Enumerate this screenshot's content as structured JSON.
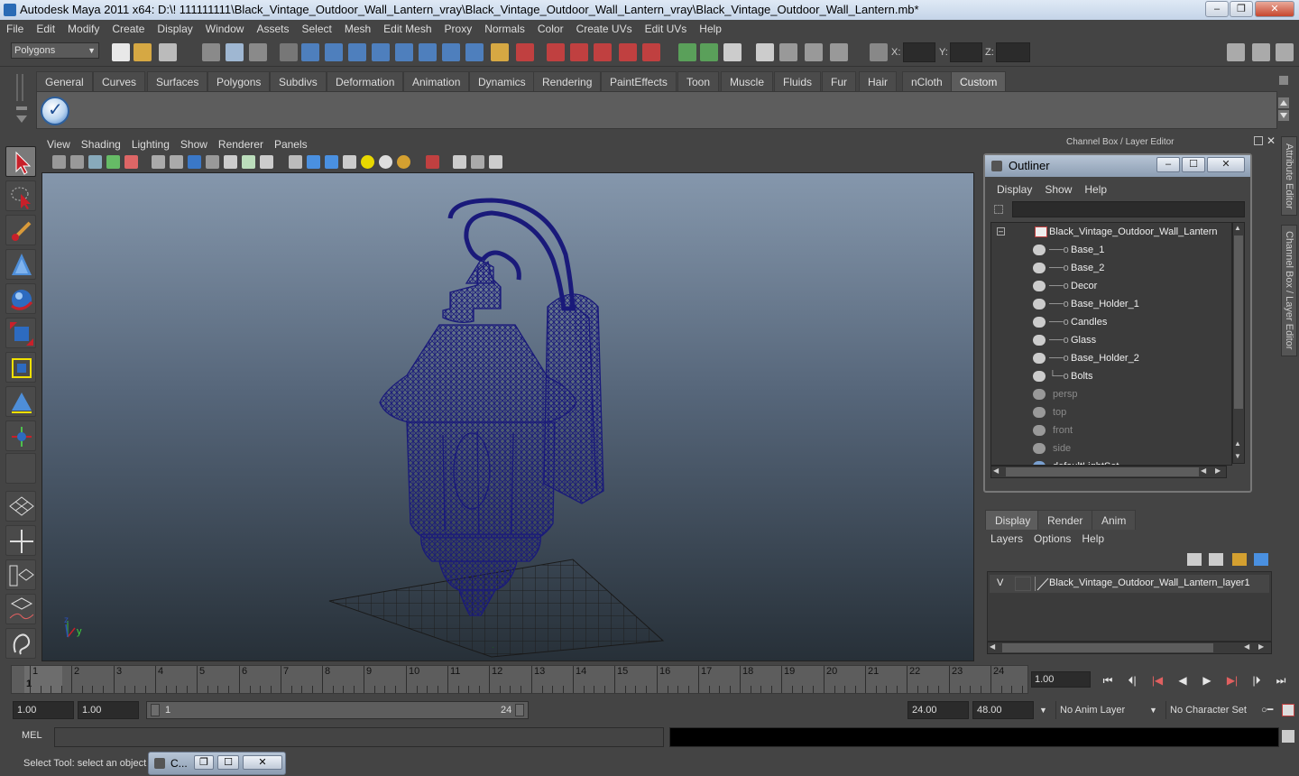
{
  "window": {
    "title": "Autodesk Maya 2011 x64: D:\\! 111111111\\Black_Vintage_Outdoor_Wall_Lantern_vray\\Black_Vintage_Outdoor_Wall_Lantern_vray\\Black_Vintage_Outdoor_Wall_Lantern.mb*",
    "minimize": "–",
    "restore": "❐",
    "close": "✕"
  },
  "menubar": [
    "File",
    "Edit",
    "Modify",
    "Create",
    "Display",
    "Window",
    "Assets",
    "Select",
    "Mesh",
    "Edit Mesh",
    "Proxy",
    "Normals",
    "Color",
    "Create UVs",
    "Edit UVs",
    "Help"
  ],
  "statusline": {
    "mode": "Polygons",
    "x_label": "X:",
    "y_label": "Y:",
    "z_label": "Z:"
  },
  "shelf": {
    "tabs": [
      "General",
      "Curves",
      "Surfaces",
      "Polygons",
      "Subdivs",
      "Deformation",
      "Animation",
      "Dynamics",
      "Rendering",
      "PaintEffects",
      "Toon",
      "Muscle",
      "Fluids",
      "Fur",
      "Hair",
      "nCloth",
      "Custom"
    ],
    "active_tab": "Custom"
  },
  "viewport": {
    "menu": [
      "View",
      "Shading",
      "Lighting",
      "Show",
      "Renderer",
      "Panels"
    ],
    "axis_y": "y",
    "axis_z": "z",
    "wire_color": "#1a1a7a"
  },
  "channelbox": {
    "header": "Channel Box / Layer Editor"
  },
  "side_tabs": {
    "attribute_editor": "Attribute Editor",
    "channel_box": "Channel Box / Layer Editor"
  },
  "outliner": {
    "title": "Outliner",
    "min": "–",
    "max": "☐",
    "close": "✕",
    "menu": [
      "Display",
      "Show",
      "Help"
    ],
    "root": "Black_Vintage_Outdoor_Wall_Lantern",
    "children": [
      "Base_1",
      "Base_2",
      "Decor",
      "Base_Holder_1",
      "Candles",
      "Glass",
      "Base_Holder_2",
      "Bolts"
    ],
    "cameras": [
      "persp",
      "top",
      "front",
      "side"
    ],
    "partial": "defaultLightSet"
  },
  "layer_editor": {
    "tabs": [
      "Display",
      "Render",
      "Anim"
    ],
    "active_tab": "Display",
    "menu": [
      "Layers",
      "Options",
      "Help"
    ],
    "layer_visibility": "V",
    "layer_name": "Black_Vintage_Outdoor_Wall_Lantern_layer1"
  },
  "timeline": {
    "ticks": [
      "1",
      "2",
      "3",
      "4",
      "5",
      "6",
      "7",
      "8",
      "9",
      "10",
      "11",
      "12",
      "13",
      "14",
      "15",
      "16",
      "17",
      "18",
      "19",
      "20",
      "21",
      "22",
      "23",
      "24"
    ],
    "current_frame_marker": "1",
    "current_frame": "1.00"
  },
  "playback": {
    "buttons": [
      "⏮",
      "⏴|",
      "|◀",
      "◀",
      "▶",
      "▶|",
      "|⏵",
      "⏭"
    ]
  },
  "range": {
    "start": "1.00",
    "playback_start": "1.00",
    "slider_start": "1",
    "slider_end": "24",
    "playback_end": "24.00",
    "end": "48.00",
    "anim_layer": "No Anim Layer",
    "character_set": "No Character Set"
  },
  "cmdline": {
    "label": "MEL"
  },
  "helpline": {
    "text": "Select Tool: select an object",
    "minwin_label": "C..."
  }
}
